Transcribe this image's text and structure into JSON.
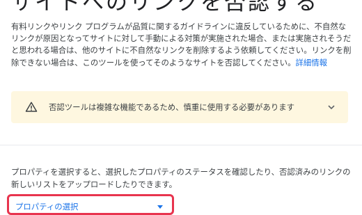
{
  "page": {
    "title": "サイトへのリンクを否認する",
    "description_text": "有料リンクやリンク プログラムが品質に関するガイドラインに違反しているために、不自然なリンクが原因となってサイトに対して手動による対策が実施された場合、または実施されそうだと思われる場合は、他のサイトに不自然なリンクを削除するよう依頼してください。リンクを削除できない場合は、このツールを使ってそのようなサイトを否認してください。",
    "learn_more_link": "詳細情報"
  },
  "warning": {
    "icon": "warning-triangle-icon",
    "text": "否認ツールは複雑な機能であるため、慎重に使用する必要があります",
    "background": "#fef7e0"
  },
  "property": {
    "description": "プロパティを選択すると、選択したプロパティのステータスを確認したり、否認済みのリンクの新しいリストをアップロードしたりできます。",
    "select_label": "プロパティの選択",
    "highlight_color": "#e8344e"
  }
}
